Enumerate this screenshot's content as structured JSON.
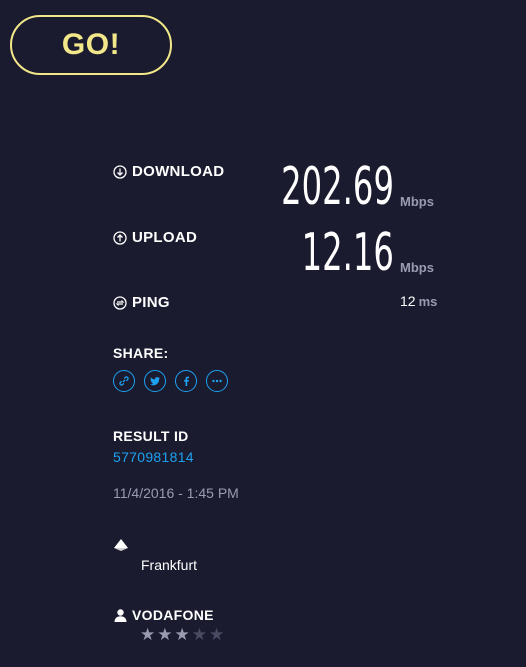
{
  "go_button": {
    "label": "GO!"
  },
  "download": {
    "label": "DOWNLOAD",
    "value": "202.69",
    "unit": "Mbps"
  },
  "upload": {
    "label": "UPLOAD",
    "value": "12.16",
    "unit": "Mbps"
  },
  "ping": {
    "label": "PING",
    "value": "12",
    "unit": "ms"
  },
  "share": {
    "label": "SHARE:",
    "icons": [
      "link-icon",
      "twitter-icon",
      "facebook-icon",
      "more-icon"
    ]
  },
  "result": {
    "label": "RESULT ID",
    "id": "5770981814",
    "timestamp": "11/4/2016 - 1:45 PM"
  },
  "server": {
    "name": "Frankfurt",
    "icon": "server-icon"
  },
  "isp": {
    "name": "VODAFONE",
    "icon": "user-icon",
    "rating": 3,
    "rating_max": 5
  },
  "colors": {
    "background": "#1a1b2e",
    "accent_yellow": "#f2e88a",
    "link_blue": "#1ea1f2",
    "muted": "#9a9bb2",
    "star_on": "#9a9bb2",
    "star_off": "#4a4b62"
  }
}
